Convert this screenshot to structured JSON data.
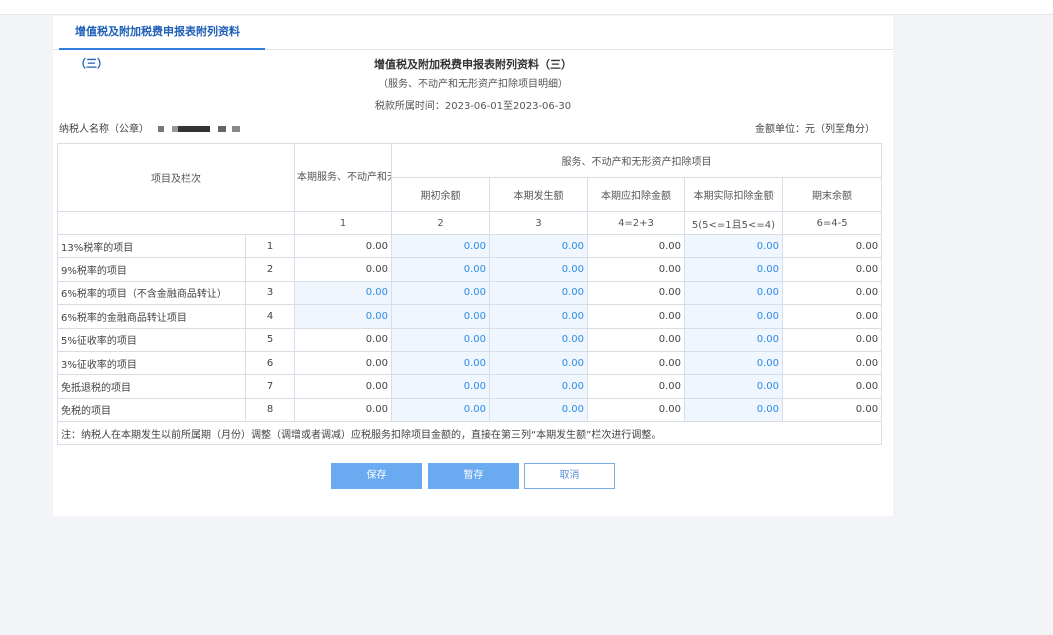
{
  "tab": {
    "label": "增值税及附加税费申报表附列资料（三）"
  },
  "form": {
    "title": "增值税及附加税费申报表附列资料（三）",
    "subtitle": "（服务、不动产和无形资产扣除项目明细）",
    "period": "税款所属时间：2023-06-01至2023-06-30",
    "taxpayer_label": "纳税人名称（公章）",
    "unit": "金额单位：元（列至角分）"
  },
  "table": {
    "header_item": "项目及栏次",
    "header_col1": "本期服务、不动产和无形资产价税合计额（免税销售额）",
    "header_group": "服务、不动产和无形资产扣除项目",
    "col_headers": [
      "期初余额",
      "本期发生额",
      "本期应扣除金额",
      "本期实际扣除金额",
      "期末余额"
    ],
    "col_numbers": [
      "1",
      "2",
      "3",
      "4=2+3",
      "5(5<=1且5<=4)",
      "6=4-5"
    ],
    "rows": [
      {
        "label": "13%税率的项目",
        "no": "1",
        "c1": "0.00",
        "c2": "0.00",
        "c3": "0.00",
        "c4": "0.00",
        "c5": "0.00",
        "c6": "0.00"
      },
      {
        "label": "9%税率的项目",
        "no": "2",
        "c1": "0.00",
        "c2": "0.00",
        "c3": "0.00",
        "c4": "0.00",
        "c5": "0.00",
        "c6": "0.00"
      },
      {
        "label": "6%税率的项目（不含金融商品转让）",
        "no": "3",
        "c1": "0.00",
        "c2": "0.00",
        "c3": "0.00",
        "c4": "0.00",
        "c5": "0.00",
        "c6": "0.00"
      },
      {
        "label": "6%税率的金融商品转让项目",
        "no": "4",
        "c1": "0.00",
        "c2": "0.00",
        "c3": "0.00",
        "c4": "0.00",
        "c5": "0.00",
        "c6": "0.00"
      },
      {
        "label": "5%征收率的项目",
        "no": "5",
        "c1": "0.00",
        "c2": "0.00",
        "c3": "0.00",
        "c4": "0.00",
        "c5": "0.00",
        "c6": "0.00"
      },
      {
        "label": "3%征收率的项目",
        "no": "6",
        "c1": "0.00",
        "c2": "0.00",
        "c3": "0.00",
        "c4": "0.00",
        "c5": "0.00",
        "c6": "0.00"
      },
      {
        "label": "免抵退税的项目",
        "no": "7",
        "c1": "0.00",
        "c2": "0.00",
        "c3": "0.00",
        "c4": "0.00",
        "c5": "0.00",
        "c6": "0.00"
      },
      {
        "label": "免税的项目",
        "no": "8",
        "c1": "0.00",
        "c2": "0.00",
        "c3": "0.00",
        "c4": "0.00",
        "c5": "0.00",
        "c6": "0.00"
      }
    ],
    "note": "注：纳税人在本期发生以前所属期（月份）调整（调增或者调减）应税服务扣除项目金额的，直接在第三列“本期发生额”栏次进行调整。"
  },
  "buttons": {
    "save": "保存",
    "draft": "暂存",
    "cancel": "取消"
  },
  "colors": {
    "accent": "#2f7fe0",
    "editable_bg": "#f0f6fd",
    "editable_text": "#2b8be6",
    "button_primary": "#6aaaf0"
  }
}
